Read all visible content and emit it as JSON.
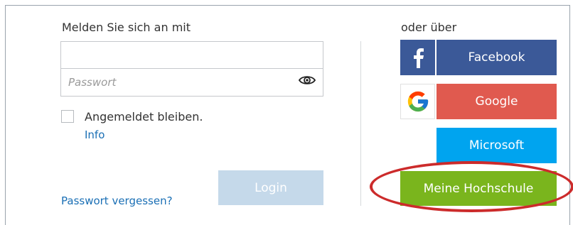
{
  "login": {
    "heading": "Melden Sie sich an mit",
    "username_value": "",
    "password_placeholder": "Passwort",
    "remember_label": "Angemeldet bleiben.",
    "info_link": "Info",
    "forgot_link": "Passwort vergessen?",
    "login_button": "Login"
  },
  "social": {
    "heading": "oder über",
    "buttons": [
      {
        "label": "Facebook",
        "color": "#3b5998",
        "icon": "facebook-icon"
      },
      {
        "label": "Google",
        "color": "#e05a4f",
        "icon": "google-icon"
      },
      {
        "label": "Microsoft",
        "color": "#00a4ef",
        "icon": "microsoft-icon"
      }
    ],
    "hochschule_button": "Meine Hochschule",
    "hochschule_color": "#7ab51d"
  },
  "annotation": {
    "highlight_color": "#cc2b2b"
  }
}
